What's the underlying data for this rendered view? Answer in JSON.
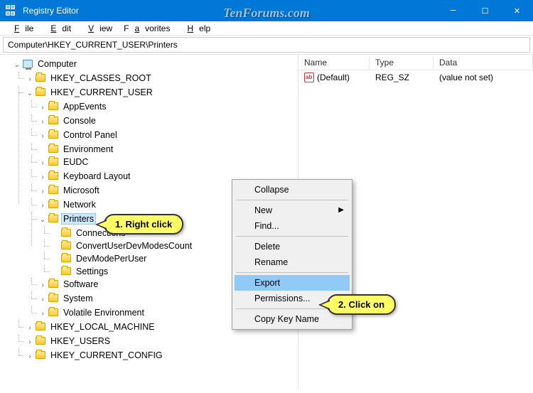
{
  "window": {
    "title": "Registry Editor"
  },
  "menu": {
    "file": "File",
    "edit": "Edit",
    "view": "View",
    "favorites": "Favorites",
    "help": "Help"
  },
  "address": {
    "path": "Computer\\HKEY_CURRENT_USER\\Printers"
  },
  "tree": {
    "root": "Computer",
    "hives": {
      "hkcr": "HKEY_CLASSES_ROOT",
      "hkcu": "HKEY_CURRENT_USER",
      "hklm": "HKEY_LOCAL_MACHINE",
      "hku": "HKEY_USERS",
      "hkcc": "HKEY_CURRENT_CONFIG"
    },
    "hkcu_children": {
      "appevents": "AppEvents",
      "console": "Console",
      "controlpanel": "Control Panel",
      "environment": "Environment",
      "eudc": "EUDC",
      "keyboard": "Keyboard Layout",
      "microsoft": "Microsoft",
      "network": "Network",
      "printers": "Printers",
      "software": "Software",
      "system": "System",
      "volatile": "Volatile Environment"
    },
    "printers_children": {
      "connections": "Connections",
      "convert": "ConvertUserDevModesCount",
      "devmode": "DevModePerUser",
      "settings": "Settings"
    }
  },
  "list": {
    "headers": {
      "name": "Name",
      "type": "Type",
      "data": "Data"
    },
    "row": {
      "name": "(Default)",
      "type": "REG_SZ",
      "data": "(value not set)"
    }
  },
  "context_menu": {
    "collapse": "Collapse",
    "new": "New",
    "find": "Find...",
    "delete": "Delete",
    "rename": "Rename",
    "export": "Export",
    "permissions": "Permissions...",
    "copykey": "Copy Key Name"
  },
  "callouts": {
    "c1": "1. Right click",
    "c2": "2. Click on"
  },
  "watermark": "TenForums.com"
}
